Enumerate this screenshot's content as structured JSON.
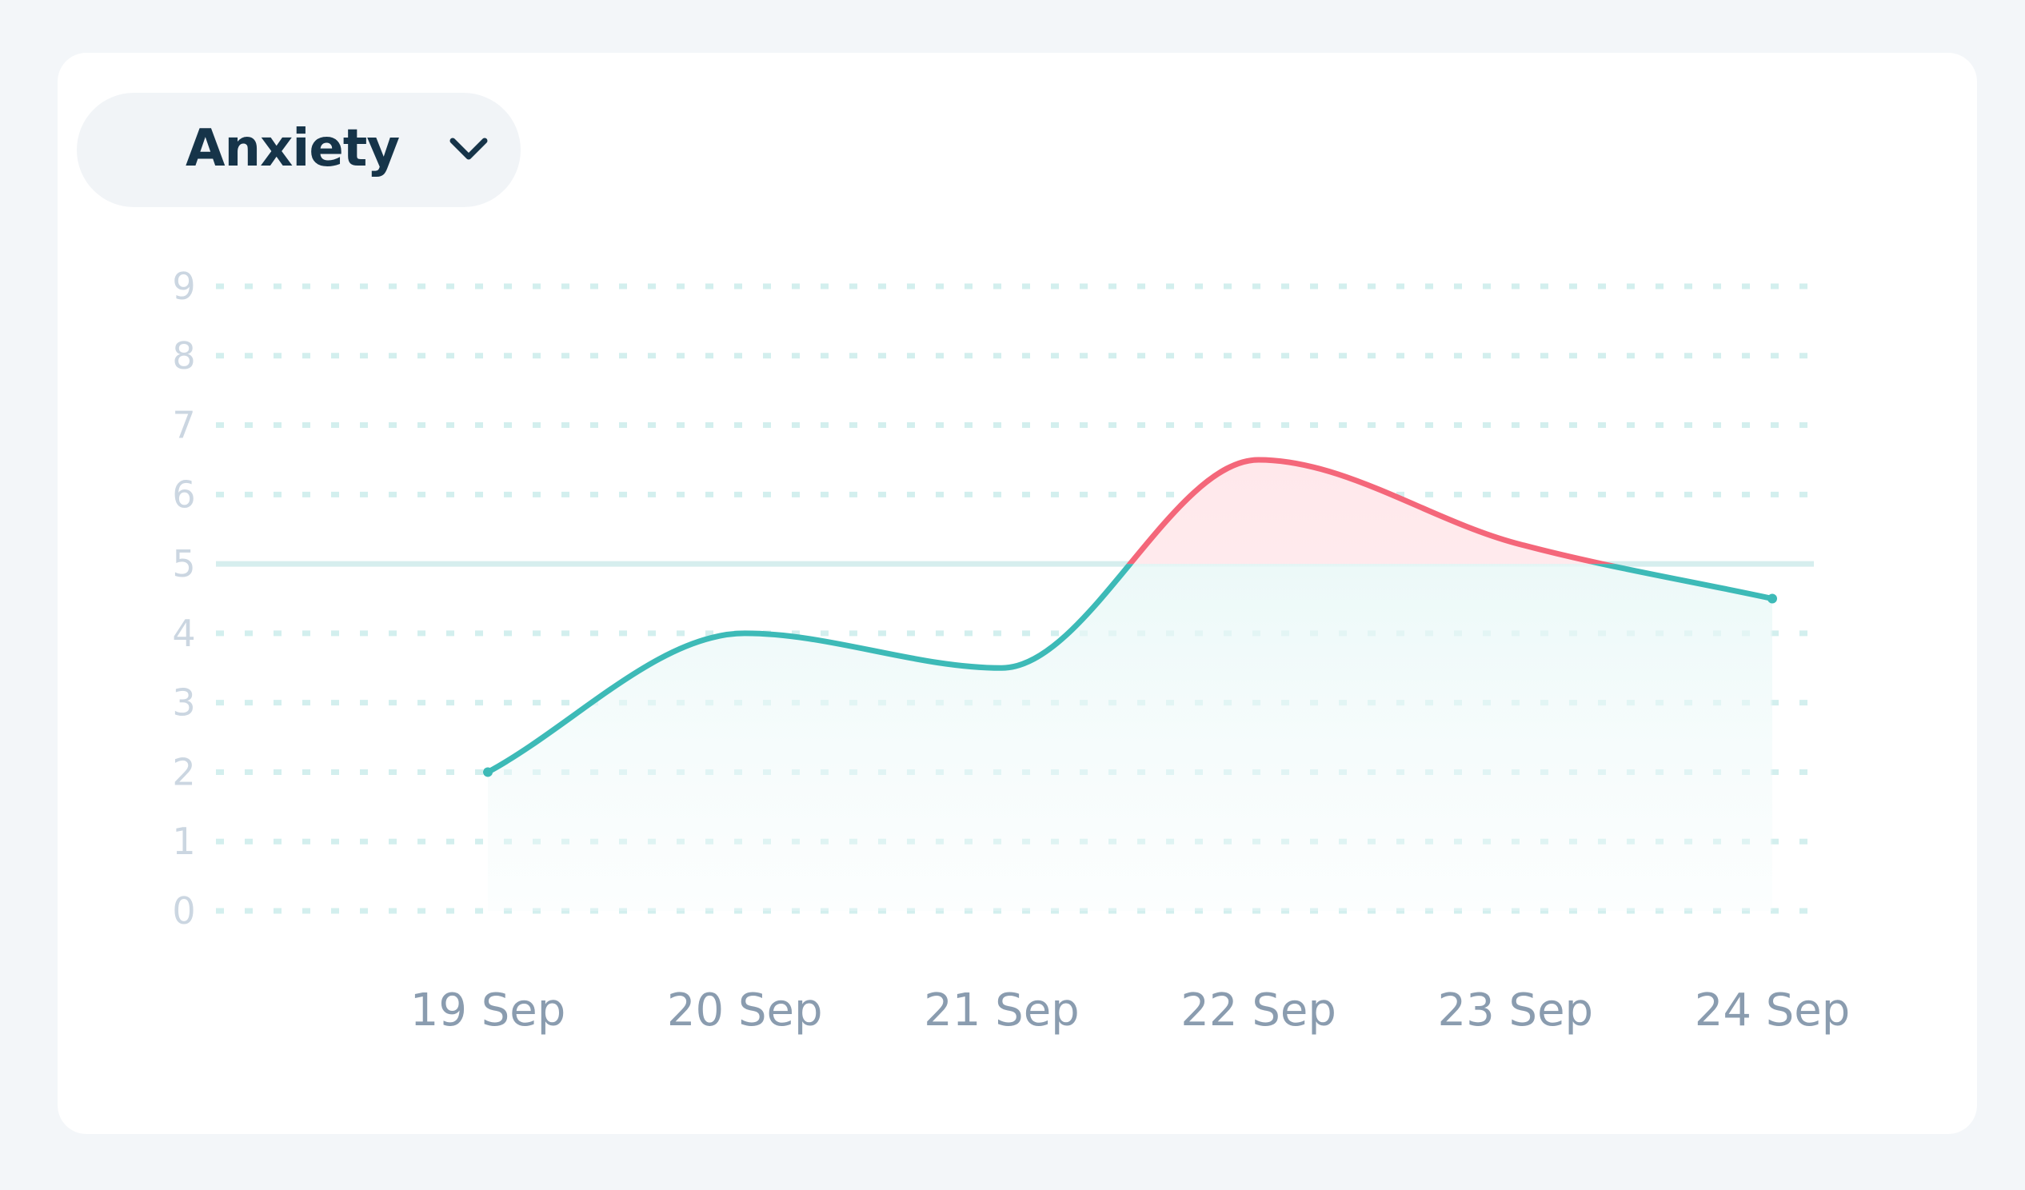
{
  "selector": {
    "label": "Anxiety",
    "icon": "chevron-down-icon"
  },
  "colors": {
    "background": "#f3f6f9",
    "card": "#ffffff",
    "below_threshold": "#3dbab7",
    "above_threshold": "#f4677a",
    "threshold_line": "#d6eeee",
    "gridline": "#d3efee"
  },
  "chart_data": {
    "type": "line",
    "title": "",
    "xlabel": "",
    "ylabel": "",
    "categories": [
      "19 Sep",
      "20 Sep",
      "21 Sep",
      "22 Sep",
      "23 Sep",
      "24 Sep"
    ],
    "y_ticks": [
      0,
      1,
      2,
      3,
      4,
      5,
      6,
      7,
      8,
      9
    ],
    "ylim": [
      0,
      9
    ],
    "threshold": 5,
    "series": [
      {
        "values": [
          2,
          4,
          3.5,
          6.5,
          5.3,
          4.5
        ]
      }
    ],
    "grid": true,
    "grid_style": "dotted",
    "fill": "gradient under line; red above threshold, teal below"
  }
}
